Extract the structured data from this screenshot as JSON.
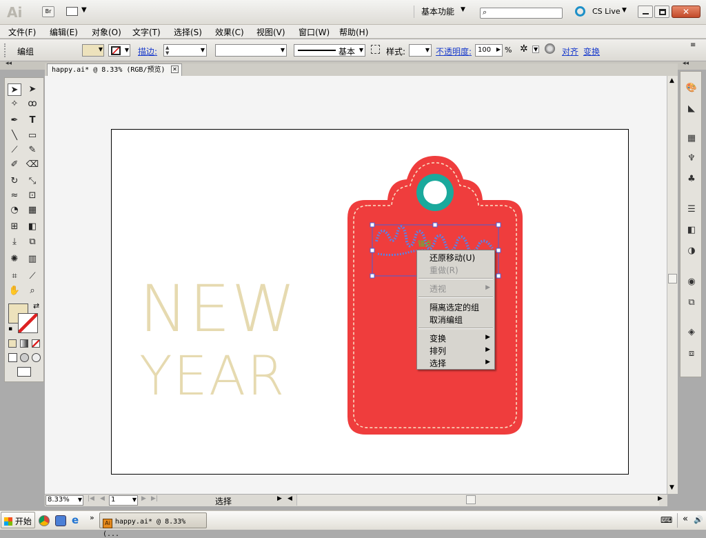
{
  "app": {
    "logo": "Ai",
    "bridge_label": "Br",
    "workspace": "基本功能",
    "cs_live": "CS Live"
  },
  "menu": [
    "文件(F)",
    "编辑(E)",
    "对象(O)",
    "文字(T)",
    "选择(S)",
    "效果(C)",
    "视图(V)",
    "窗口(W)",
    "帮助(H)"
  ],
  "control": {
    "selection_type": "编组",
    "stroke_label": "描边:",
    "stroke_profile": "基本",
    "style_label": "样式:",
    "opacity_label": "不透明度:",
    "opacity_value": "100",
    "opacity_unit": "%",
    "align_label": "对齐",
    "transform_label": "变换"
  },
  "document": {
    "tab_title": "happy.ai* @ 8.33% (RGB/预览)"
  },
  "artwork": {
    "line1": "NEW",
    "line2": "YEAR",
    "anchor_hint": "锚点",
    "tag_color": "#ef3d3d",
    "ring_color": "#1aa99c",
    "text_color": "#e6dab0"
  },
  "context_menu": {
    "undo": "还原移动(U)",
    "redo": "重做(R)",
    "perspective": "透视",
    "isolate": "隔离选定的组",
    "ungroup": "取消编组",
    "transform": "变换",
    "arrange": "排列",
    "select": "选择"
  },
  "status": {
    "zoom": "8.33%",
    "page": "1",
    "mode": "选择"
  },
  "taskbar": {
    "start": "开始",
    "task_item": "happy.ai* @ 8.33% (..."
  }
}
